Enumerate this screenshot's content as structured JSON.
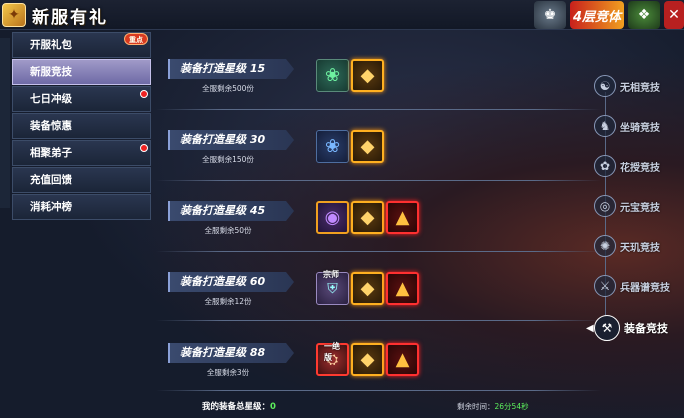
{
  "window": {
    "title": "新服有礼",
    "emblem": "✦"
  },
  "top_icons": [
    {
      "name": "ranking-icon",
      "glyph": "♚"
    },
    {
      "name": "event-banner",
      "text": "4层竞体"
    },
    {
      "name": "gift-icon",
      "glyph": "❖"
    },
    {
      "name": "close-icon",
      "glyph": "✕"
    }
  ],
  "sidebar": {
    "items": [
      {
        "label": "开服礼包",
        "badge": "重点",
        "dot": false,
        "active": false
      },
      {
        "label": "新服竞技",
        "badge": "",
        "dot": false,
        "active": true
      },
      {
        "label": "七日冲级",
        "badge": "",
        "dot": true,
        "active": false
      },
      {
        "label": "装备惊惠",
        "badge": "",
        "dot": false,
        "active": false
      },
      {
        "label": "相聚弟子",
        "badge": "",
        "dot": true,
        "active": false
      },
      {
        "label": "充值回馈",
        "badge": "",
        "dot": false,
        "active": false
      },
      {
        "label": "消耗冲榜",
        "badge": "",
        "dot": false,
        "active": false
      }
    ]
  },
  "rows": [
    {
      "title": "装备打造星级 15",
      "remain": "全服剩余500份",
      "items": [
        "green",
        "gold"
      ]
    },
    {
      "title": "装备打造星级 30",
      "remain": "全服剩余150份",
      "items": [
        "blue",
        "gold"
      ]
    },
    {
      "title": "装备打造星级 45",
      "remain": "全服剩余50份",
      "items": [
        "purple",
        "gold",
        "red"
      ]
    },
    {
      "title": "装备打造星级 60",
      "remain": "全服剩余12份",
      "items": [
        "gear",
        "gold",
        "red"
      ],
      "tag": "宗师"
    },
    {
      "title": "装备打造星级 88",
      "remain": "全服剩余3份",
      "items": [
        "gear-red",
        "gold",
        "red"
      ],
      "tag": "一绝版"
    }
  ],
  "right_nav": {
    "items": [
      {
        "label": "无相竞技",
        "glyph": "☯",
        "active": false
      },
      {
        "label": "坐骑竞技",
        "glyph": "♞",
        "active": false
      },
      {
        "label": "花授竞技",
        "glyph": "✿",
        "active": false
      },
      {
        "label": "元宝竞技",
        "glyph": "◎",
        "active": false
      },
      {
        "label": "天玑竞技",
        "glyph": "✺",
        "active": false
      },
      {
        "label": "兵器谱竞技",
        "glyph": "⚔",
        "active": false
      },
      {
        "label": "装备竞技",
        "glyph": "⚒",
        "active": true
      }
    ]
  },
  "footer": {
    "total_label": "我的装备总星级：",
    "total_value": "0",
    "time_label": "剩余时间：",
    "time_value": "26分54秒"
  }
}
